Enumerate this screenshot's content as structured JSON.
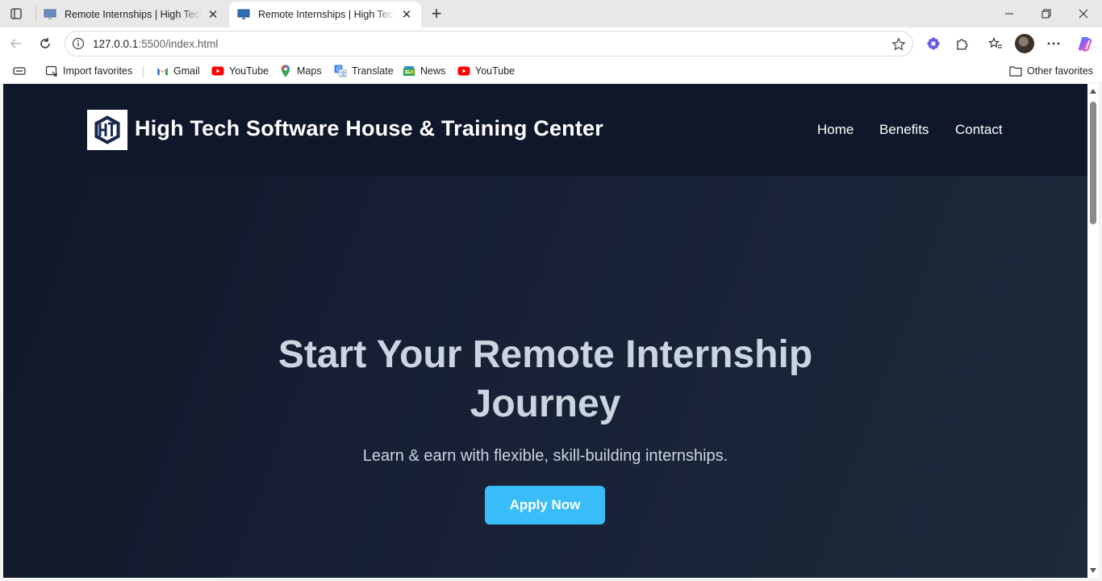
{
  "browser": {
    "tabs": [
      {
        "title": "Remote Internships | High Tech So",
        "active": false
      },
      {
        "title": "Remote Internships | High Tech So",
        "active": true
      }
    ],
    "address": {
      "host": "127.0.0.1",
      "path": ":5500/index.html"
    },
    "favorites": [
      {
        "label": "Import favorites",
        "icon": "import-icon"
      },
      {
        "label": "Gmail",
        "icon": "gmail-icon"
      },
      {
        "label": "YouTube",
        "icon": "youtube-icon"
      },
      {
        "label": "Maps",
        "icon": "maps-icon"
      },
      {
        "label": "Translate",
        "icon": "translate-icon"
      },
      {
        "label": "News",
        "icon": "news-icon"
      },
      {
        "label": "YouTube",
        "icon": "youtube-icon"
      }
    ],
    "other_favorites": "Other favorites"
  },
  "site": {
    "brand": "High Tech Software House & Training Center",
    "nav": [
      {
        "label": "Home"
      },
      {
        "label": "Benefits"
      },
      {
        "label": "Contact"
      }
    ],
    "hero": {
      "title": "Start Your Remote Internship Journey",
      "subtitle": "Learn & earn with flexible, skill-building internships.",
      "cta": "Apply Now"
    }
  },
  "colors": {
    "header_bg": "#0f172a",
    "hero_text": "#cbd5e1",
    "accent": "#38bdf8"
  }
}
